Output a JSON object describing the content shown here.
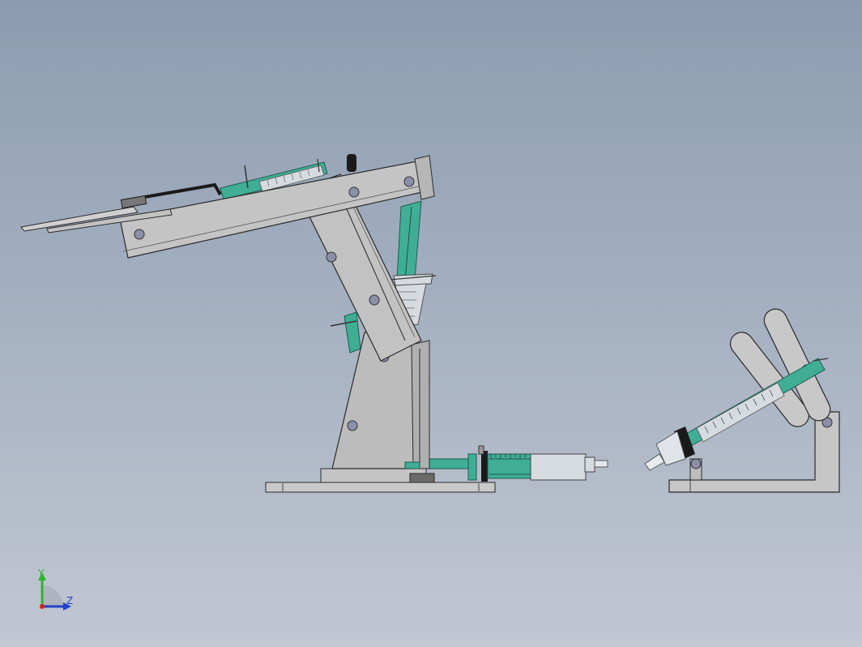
{
  "viewport": {
    "background_top": "#8c9cb0",
    "background_bottom": "#c2c7d2"
  },
  "model": {
    "part_fill": "#b8b8b8",
    "part_face_light": "#cfcfcf",
    "outline": "#2a2a2a",
    "syringe_fill": "#3fae95",
    "syringe_barrel": "#d6dbe0",
    "pin_fill": "#8b8fa8",
    "clamp_fill": "#1a1a1a"
  },
  "triad": {
    "y_label": "Y",
    "z_label": "Z",
    "y_color": "#2db52d",
    "z_color": "#2040c8",
    "x_color": "#d02020"
  }
}
